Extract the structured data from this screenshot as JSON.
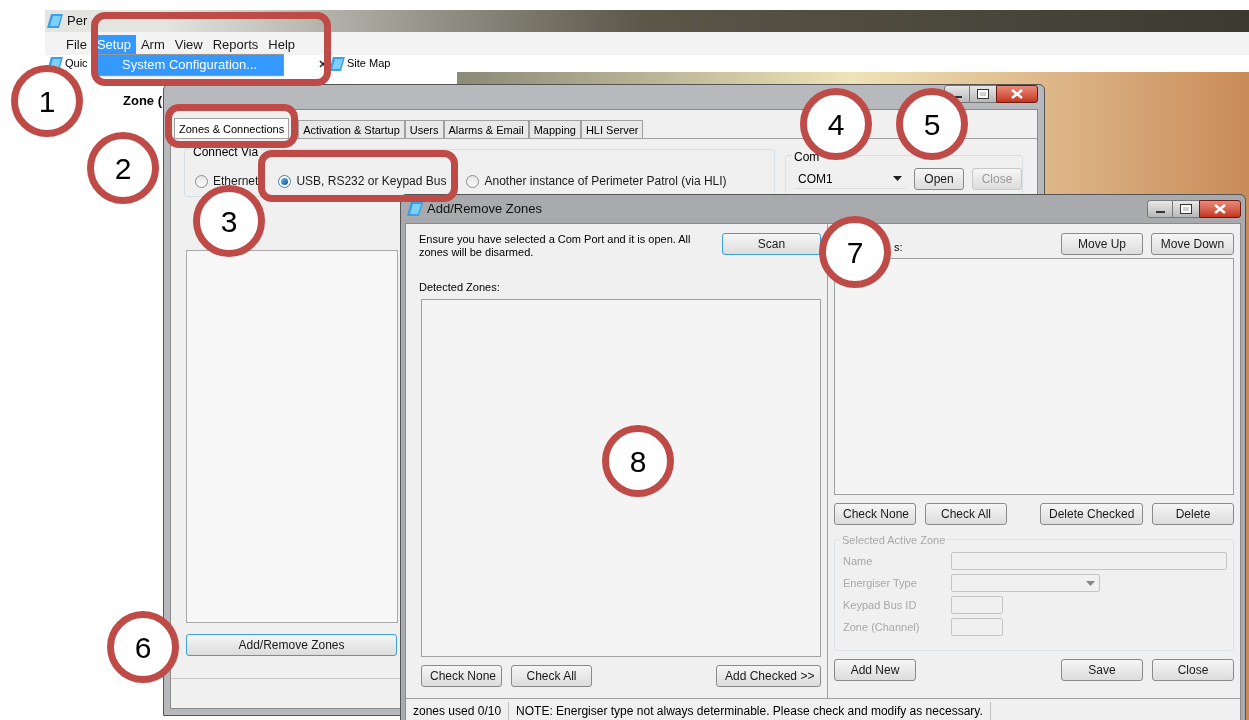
{
  "main_window": {
    "title": "Per",
    "menu": [
      {
        "label": "File",
        "selected": false
      },
      {
        "label": "Setup",
        "selected": true
      },
      {
        "label": "Arm",
        "selected": false
      },
      {
        "label": "View",
        "selected": false
      },
      {
        "label": "Reports",
        "selected": false
      },
      {
        "label": "Help",
        "selected": false
      }
    ],
    "open_menu": [
      {
        "label": "System Configuration...",
        "selected": true
      }
    ],
    "toolbar": [
      "Quic",
      "Site Map"
    ],
    "zone_label": "Zone ("
  },
  "config_window": {
    "tabs": [
      {
        "label": "Zones & Connections",
        "selected": true
      },
      {
        "label": "Activation & Startup",
        "selected": false
      },
      {
        "label": "Users",
        "selected": false
      },
      {
        "label": "Alarms & Email",
        "selected": false
      },
      {
        "label": "Mapping",
        "selected": false
      },
      {
        "label": "HLI Server",
        "selected": false
      }
    ],
    "connect_via": {
      "title": "Connect Via",
      "options": [
        {
          "label": "Ethernet",
          "selected": false
        },
        {
          "label": "USB, RS232 or Keypad Bus",
          "selected": true
        },
        {
          "label": "Another instance of Perimeter Patrol (via HLI)",
          "selected": false
        }
      ]
    },
    "com_port": {
      "title": "Com",
      "value": "COM1",
      "buttons": [
        {
          "label": "Open",
          "disabled": false
        },
        {
          "label": "Close",
          "disabled": true
        }
      ]
    },
    "add_remove_button": "Add/Remove Zones"
  },
  "zones_dialog": {
    "title": "Add/Remove Zones",
    "instructions": "Ensure you have selected a Com Port and it is open. All zones will be disarmed.",
    "scan_button": "Scan",
    "detected_label": "Detected Zones:",
    "left_buttons": [
      "Check None",
      "Check All",
      "Add Checked >>"
    ],
    "active_label": "s:",
    "move_buttons": [
      "Move Up",
      "Move Down"
    ],
    "active_buttons": [
      "Check None",
      "Check All",
      "Delete Checked",
      "Delete"
    ],
    "selected_zone": {
      "title": "Selected Active Zone",
      "disabled": true,
      "fields": [
        {
          "label": "Name",
          "kind": "text"
        },
        {
          "label": "Energiser Type",
          "kind": "select"
        },
        {
          "label": "Keypad Bus ID",
          "kind": "short"
        },
        {
          "label": "Zone (Channel)",
          "kind": "short"
        }
      ]
    },
    "bottom_buttons": [
      "Add New",
      "Save",
      "Close"
    ],
    "status_bar": [
      "zones used 0/10",
      "NOTE: Energiser type not always determinable. Please check and modify as necessary."
    ]
  },
  "callouts": [
    "1",
    "2",
    "3",
    "4",
    "5",
    "6",
    "7",
    "8"
  ]
}
